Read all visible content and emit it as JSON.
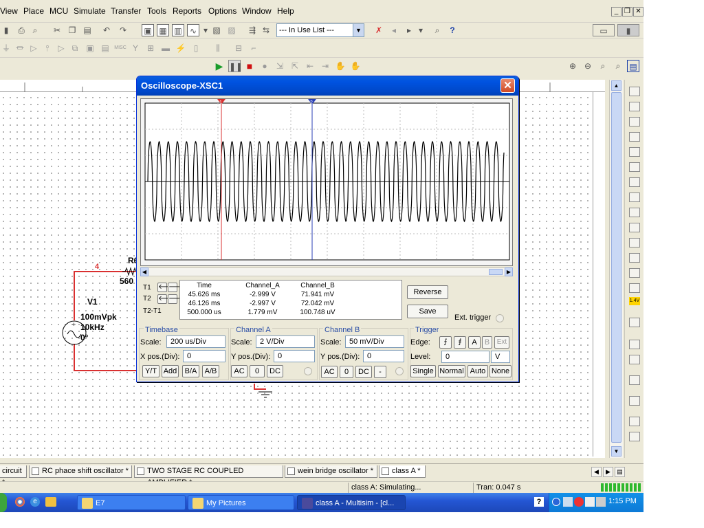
{
  "menu": [
    "View",
    "Place",
    "MCU",
    "Simulate",
    "Transfer",
    "Tools",
    "Reports",
    "Options",
    "Window",
    "Help"
  ],
  "toolbar": {
    "in_use_list": "--- In Use List ---"
  },
  "circuit": {
    "net_label": "4",
    "resistor_ref": "R6",
    "resistor_value": "560",
    "source_name": "V1",
    "source_amplitude": "100mVpk",
    "source_freq": "10kHz",
    "source_phase": "0°"
  },
  "scope": {
    "title": "Oscilloscope-XSC1",
    "close": "✕",
    "cursor1_label": "1",
    "cursor2_label": "2",
    "readout": {
      "headers": [
        "Time",
        "Channel_A",
        "Channel_B"
      ],
      "rows": [
        {
          "label": "T1",
          "time": "45.626 ms",
          "a": "-2.999 V",
          "b": "71.941 mV"
        },
        {
          "label": "T2",
          "time": "46.126 ms",
          "a": "-2.997 V",
          "b": "72.042 mV"
        },
        {
          "label": "T2-T1",
          "time": "500.000 us",
          "a": "1.779 mV",
          "b": "100.748 uV"
        }
      ]
    },
    "buttons": {
      "reverse": "Reverse",
      "save": "Save",
      "ext_trigger": "Ext. trigger"
    },
    "timebase": {
      "title": "Timebase",
      "scale_label": "Scale:",
      "scale": "200 us/Div",
      "xpos_label": "X pos.(Div):",
      "xpos": "0",
      "modes": [
        "Y/T",
        "Add",
        "B/A",
        "A/B"
      ]
    },
    "channel_a": {
      "title": "Channel A",
      "scale_label": "Scale:",
      "scale": "2  V/Div",
      "ypos_label": "Y pos.(Div):",
      "ypos": "0",
      "coupling": [
        "AC",
        "0",
        "DC"
      ]
    },
    "channel_b": {
      "title": "Channel B",
      "scale_label": "Scale:",
      "scale": "50 mV/Div",
      "ypos_label": "Y pos.(Div):",
      "ypos": "0",
      "coupling": [
        "AC",
        "0",
        "DC",
        "-"
      ]
    },
    "trigger": {
      "title": "Trigger",
      "edge_label": "Edge:",
      "edge_rise": "⨍",
      "edge_fall": "⨎",
      "sources": [
        "A",
        "B",
        "Ext"
      ],
      "level_label": "Level:",
      "level": "0",
      "level_unit": "V",
      "modes": [
        "Single",
        "Normal",
        "Auto",
        "None"
      ]
    }
  },
  "sheet_tabs": [
    "circuit *",
    "RC phace shift oscillator *",
    "TWO STAGE RC COUPLED AMPLIFIER *",
    "wein bridge oscillator *",
    "class A *"
  ],
  "status": {
    "sim": "class A: Simulating...",
    "tran": "Tran: 0.047 s"
  },
  "taskbar": {
    "tasks": [
      "E7",
      "My Pictures",
      "class A - Multisim - [cl..."
    ],
    "clock": "1:15 PM",
    "help": "?"
  },
  "sidebar": {
    "voltage_badge": "1.4V"
  }
}
